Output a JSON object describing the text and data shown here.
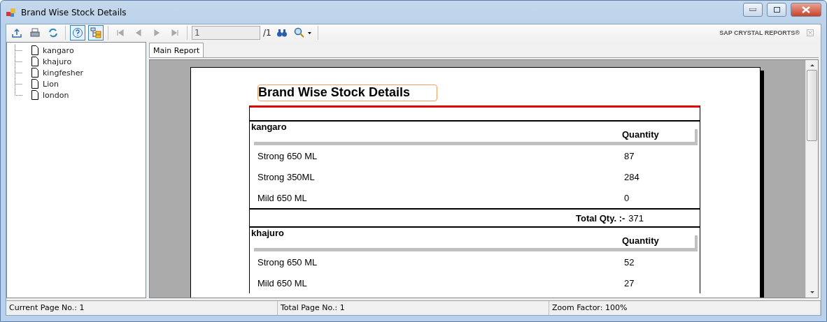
{
  "window": {
    "title": "Brand Wise Stock Details"
  },
  "toolbar": {
    "toggle_buttons": [
      {
        "pressed": true
      },
      {
        "pressed": true
      }
    ],
    "nav_buttons": [
      {
        "disabled": true
      },
      {
        "disabled": true
      },
      {
        "disabled": true
      },
      {
        "disabled": true
      }
    ],
    "page_field": {
      "value": "1"
    },
    "page_total": "/1",
    "brand": "SAP CRYSTAL REPORTS®"
  },
  "tree": {
    "items": [
      {
        "label": "kangaro"
      },
      {
        "label": "khajuro"
      },
      {
        "label": "kingfesher"
      },
      {
        "label": "Lion"
      },
      {
        "label": "london"
      }
    ]
  },
  "tabs": [
    {
      "label": "Main Report",
      "selected": true
    }
  ],
  "report": {
    "title": "Brand Wise Stock Details",
    "groups": [
      {
        "name": "kangaro",
        "column": "Quantity",
        "rows": [
          {
            "product": "Strong 650 ML",
            "quantity": "87"
          },
          {
            "product": "Strong 350ML",
            "quantity": "284"
          },
          {
            "product": "Mild 650 ML",
            "quantity": "0"
          }
        ],
        "total_label": "Total Qty. :-",
        "total": "371"
      },
      {
        "name": "khajuro",
        "column": "Quantity",
        "rows": [
          {
            "product": "Strong 650 ML",
            "quantity": "52"
          },
          {
            "product": "Mild 650 ML",
            "quantity": "27"
          }
        ]
      }
    ]
  },
  "status_bar": [
    "Current Page No.: 1",
    "Total Page No.: 1",
    "Zoom Factor: 100%"
  ]
}
